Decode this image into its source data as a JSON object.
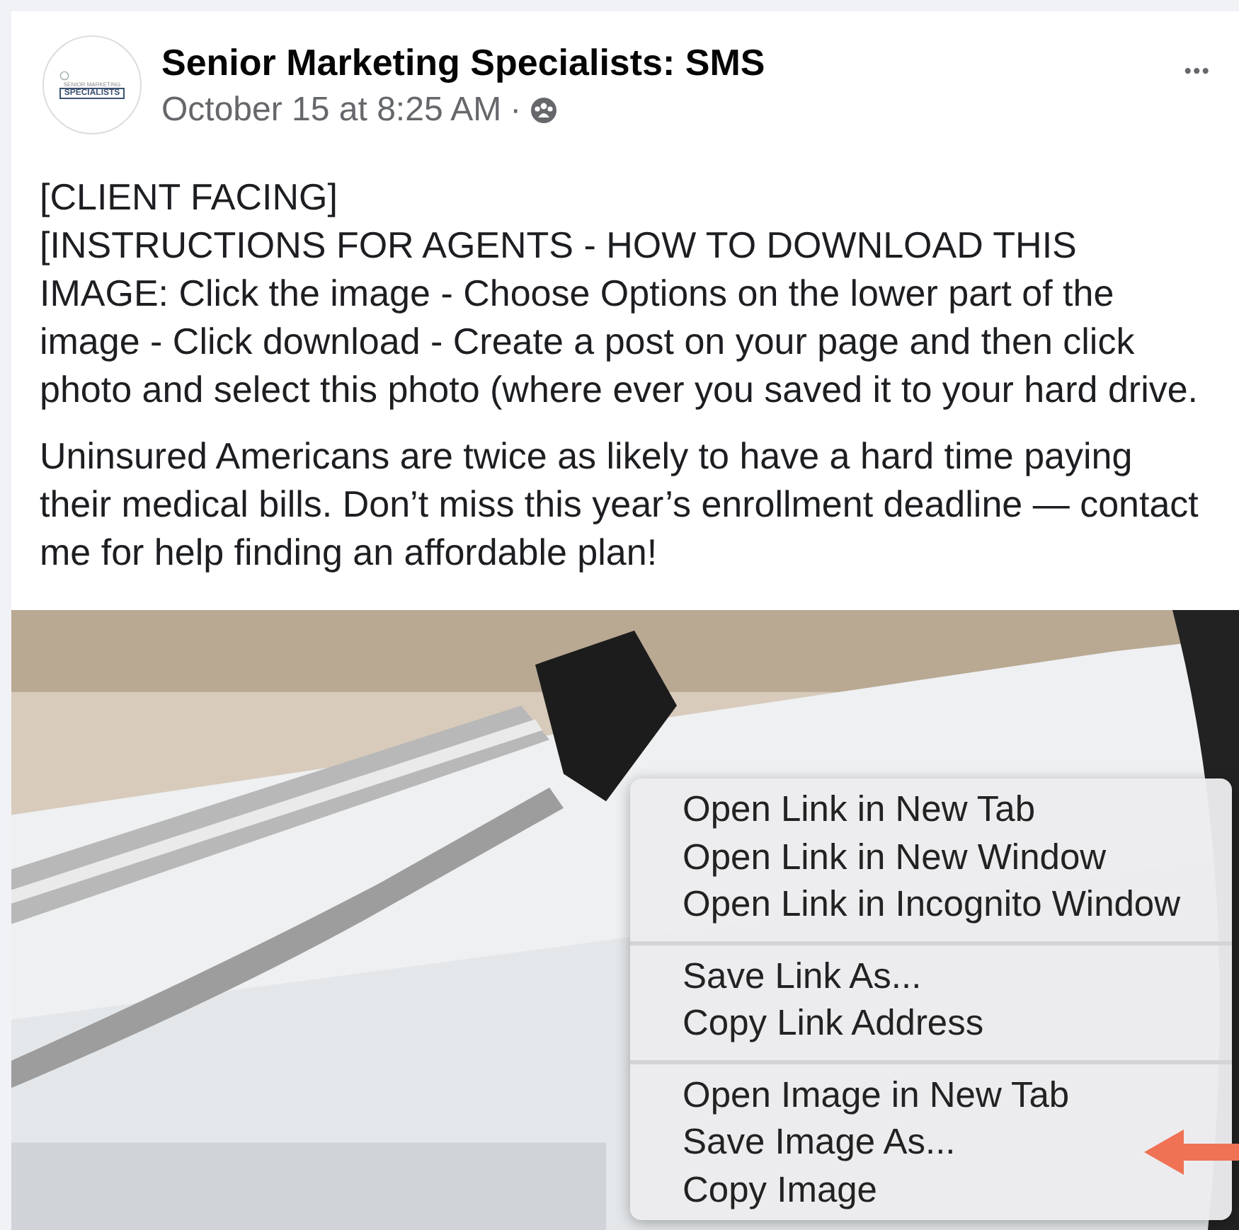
{
  "post": {
    "author": "Senior Marketing Specialists: SMS",
    "logo_lines": [
      "SENIOR MARKETING",
      "SPECIALISTS"
    ],
    "timestamp": "October 15 at 8:25 AM",
    "separator": "·",
    "more_label": "•••",
    "paragraphs": [
      [
        "[CLIENT FACING]",
        "[INSTRUCTIONS FOR AGENTS - HOW TO DOWNLOAD THIS IMAGE: Click the image - Choose Options on the lower part of the image - Click download - Create a post on your page and then click photo and select this photo (where ever you saved it to your hard drive."
      ],
      [
        "Uninsured Americans are twice as likely to have a hard time paying their medical bills. Don’t miss this year’s enrollment deadline — contact me for help finding an affordable plan!"
      ]
    ]
  },
  "context_menu": {
    "groups": [
      [
        "Open Link in New Tab",
        "Open Link in New Window",
        "Open Link in Incognito Window"
      ],
      [
        "Save Link As...",
        "Copy Link Address"
      ],
      [
        "Open Image in New Tab",
        "Save Image As...",
        "Copy Image"
      ]
    ]
  },
  "pointer_arrow": {
    "color": "#ef7254"
  }
}
